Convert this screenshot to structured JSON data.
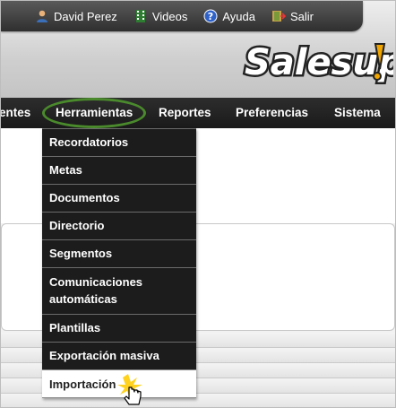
{
  "topbar": {
    "user_name": "David Perez",
    "videos_label": "Videos",
    "help_label": "Ayuda",
    "exit_label": "Salir"
  },
  "logo": {
    "text": "Salesup!"
  },
  "nav": {
    "items": [
      "entes",
      "Herramientas",
      "Reportes",
      "Preferencias",
      "Sistema"
    ]
  },
  "dropdown": {
    "items": [
      "Recordatorios",
      "Metas",
      "Documentos",
      "Directorio",
      "Segmentos",
      "Comunicaciones automáticas",
      "Plantillas",
      "Exportación masiva",
      "Importación"
    ]
  },
  "colors": {
    "nav_bg": "#1a1a1a",
    "highlight_ring": "#4a8a2c",
    "logo_accent": "#f0a500"
  }
}
